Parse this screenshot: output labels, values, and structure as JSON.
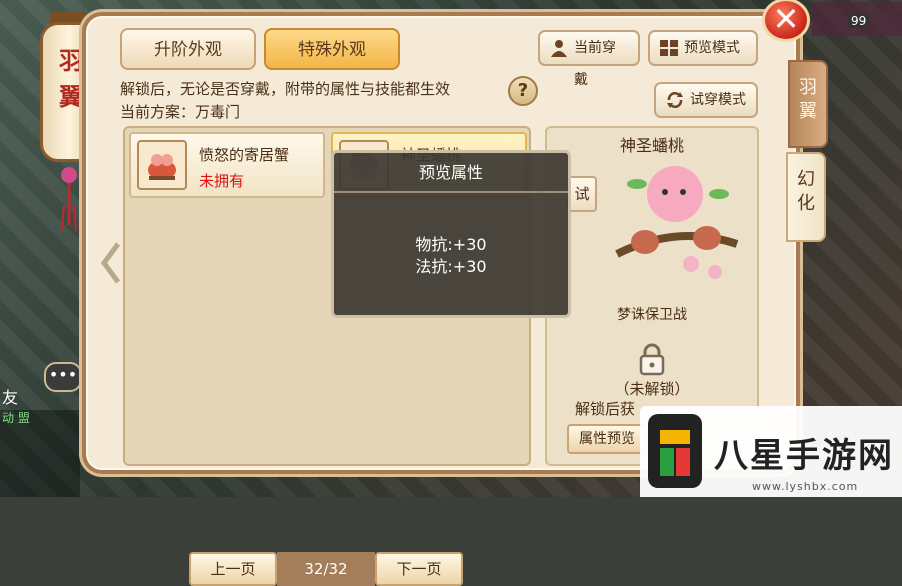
{
  "tabs": {
    "upgrade_label": "升阶外观",
    "special_label": "特殊外观"
  },
  "toolbar": {
    "current_wear_label": "当前穿戴",
    "preview_mode_label": "预览模式",
    "tryon_mode_label": "试穿模式"
  },
  "info": {
    "line1": "解锁后，无论是否穿戴，附带的属性与技能都生效",
    "line2": "当前方案：万毒门",
    "help_label": "?"
  },
  "items": [
    {
      "name": "愤怒的寄居蟹",
      "status": "未拥有"
    },
    {
      "name": "神圣蟠桃",
      "status": ""
    }
  ],
  "pager": {
    "prev_label": "上一页",
    "next_label": "下一页",
    "page_text": "32/32"
  },
  "preview": {
    "title": "神圣蟠桃",
    "source": "梦诛保卫战",
    "lock_text": "（未解锁）",
    "unlock_hint": "解锁后获",
    "attr_button": "属性预览",
    "tryon_short": "试"
  },
  "popup": {
    "title": "预览属性",
    "lines": [
      "物抗:+30",
      "法抗:+30"
    ]
  },
  "side_tabs": [
    {
      "label": "羽翼",
      "active": false
    },
    {
      "label": "幻化",
      "active": true
    }
  ],
  "lantern": {
    "label": "羽翼"
  },
  "chat": {
    "friend_label": "友",
    "chat_icon": "•••",
    "lines": [
      "动 盟"
    ]
  },
  "level_badge": "99",
  "close_icon": "✕",
  "watermark": {
    "title": "八星手游网",
    "url": "www.lyshbx.com"
  },
  "colors": {
    "panel_bg": "#f4ead7",
    "accent": "#f2b546",
    "status_red": "#e01010"
  }
}
